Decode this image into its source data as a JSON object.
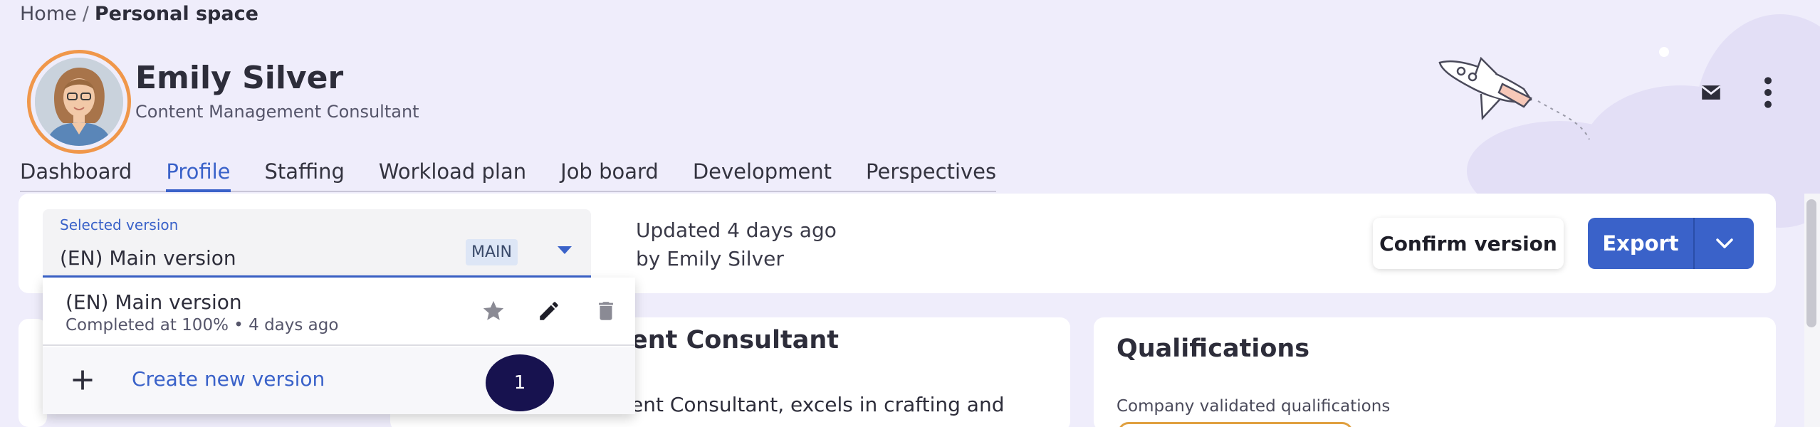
{
  "breadcrumb": {
    "home": "Home",
    "separator": "/",
    "current": "Personal space"
  },
  "user": {
    "name": "Emily Silver",
    "title": "Content Management Consultant"
  },
  "header_icons": [
    "mail-icon",
    "more-vertical-icon"
  ],
  "tabs": [
    {
      "label": "Dashboard",
      "active": false
    },
    {
      "label": "Profile",
      "active": true
    },
    {
      "label": "Staffing",
      "active": false
    },
    {
      "label": "Workload plan",
      "active": false
    },
    {
      "label": "Job board",
      "active": false
    },
    {
      "label": "Development",
      "active": false
    },
    {
      "label": "Perspectives",
      "active": false
    }
  ],
  "version_select": {
    "label": "Selected version",
    "value": "(EN) Main version",
    "badge": "MAIN"
  },
  "updated": {
    "line1": "Updated 4 days ago",
    "line2": "by Emily Silver"
  },
  "actions": {
    "confirm": "Confirm version",
    "export": "Export"
  },
  "dropdown": {
    "items": [
      {
        "title": "(EN) Main version",
        "subtitle": "Completed at 100% • 4 days ago"
      }
    ],
    "create_label": "Create new version"
  },
  "marker": "1",
  "main_card": {
    "title_fragment": "ent Consultant",
    "text_fragment": "ent Consultant, excels in crafting and"
  },
  "qualifications": {
    "title": "Qualifications",
    "subtitle": "Company validated qualifications"
  },
  "colors": {
    "accent": "#3a62c9",
    "avatar_ring": "#f0974a",
    "background": "#efedfb",
    "marker": "#17124f"
  }
}
